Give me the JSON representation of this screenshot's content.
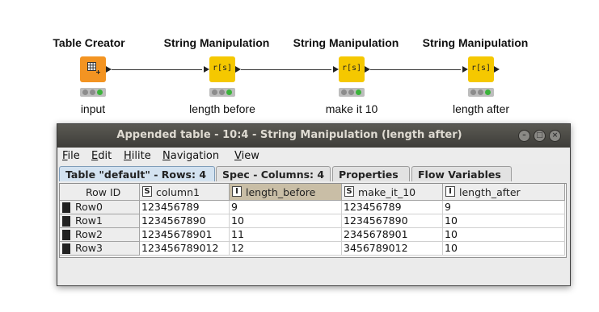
{
  "workflow": {
    "nodes": [
      {
        "title": "Table Creator",
        "label": "input",
        "icon": "table-grid-icon",
        "color": "#f39422"
      },
      {
        "title": "String Manipulation",
        "label": "length before",
        "icon_text": "r[s]",
        "color": "#f5c800"
      },
      {
        "title": "String Manipulation",
        "label": "make it 10",
        "icon_text": "r[s]",
        "color": "#f5c800"
      },
      {
        "title": "String Manipulation",
        "label": "length after",
        "icon_text": "r[s]",
        "color": "#f5c800"
      }
    ],
    "status_colors": {
      "inactive": "#8c8c8c",
      "executed": "#3bb33b"
    }
  },
  "dialog": {
    "title": "Appended table - 10:4 - String Manipulation (length after)",
    "menu": [
      {
        "key": "F",
        "rest": "ile"
      },
      {
        "key": "E",
        "rest": "dit"
      },
      {
        "key": "H",
        "rest": "ilite"
      },
      {
        "key": "N",
        "rest": "avigation"
      },
      {
        "key": "V",
        "rest": "iew"
      }
    ],
    "tabs": [
      "Table \"default\" - Rows: 4",
      "Spec - Columns: 4",
      "Properties",
      "Flow Variables"
    ],
    "table": {
      "row_id_header": "Row ID",
      "columns": [
        {
          "type": "S",
          "name": "column1"
        },
        {
          "type": "I",
          "name": "length_before"
        },
        {
          "type": "S",
          "name": "make_it_10"
        },
        {
          "type": "I",
          "name": "length_after"
        }
      ],
      "rows": [
        {
          "id": "Row0",
          "cells": [
            "123456789",
            "9",
            "123456789",
            "9"
          ]
        },
        {
          "id": "Row1",
          "cells": [
            "1234567890",
            "10",
            "1234567890",
            "10"
          ]
        },
        {
          "id": "Row2",
          "cells": [
            "12345678901",
            "11",
            "2345678901",
            "10"
          ]
        },
        {
          "id": "Row3",
          "cells": [
            "123456789012",
            "12",
            "3456789012",
            "10"
          ]
        }
      ]
    }
  }
}
